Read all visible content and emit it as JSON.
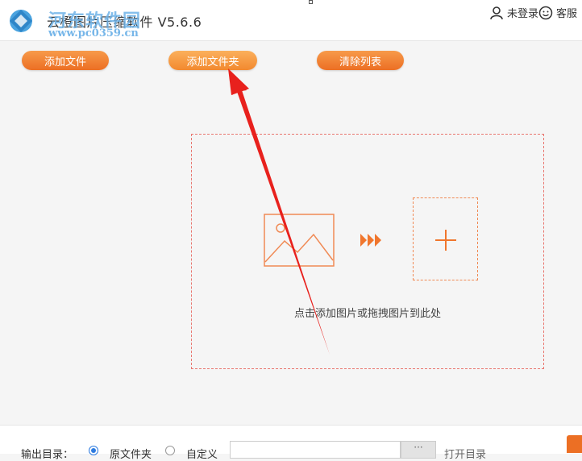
{
  "app": {
    "title": "云橙图片压缩软件 V5.6.6",
    "watermark_name": "河东软件园",
    "watermark_url": "www.pc0359.cn"
  },
  "header": {
    "login_label": "未登录",
    "service_label": "客服"
  },
  "toolbar": {
    "add_file": "添加文件",
    "add_folder": "添加文件夹",
    "clear_list": "清除列表"
  },
  "drop_zone": {
    "hint": "点击添加图片或拖拽图片到此处"
  },
  "output": {
    "label": "输出目录：",
    "option_original": "原文件夹",
    "option_custom": "自定义",
    "selected": "原文件夹",
    "path_value": "",
    "browse_label": "···",
    "open_dir": "打开目录"
  },
  "colors": {
    "accent": "#ec6f24",
    "drop_border": "#e9766f",
    "radio_checked": "#2d7be0",
    "annotation_arrow": "#e8211d"
  },
  "icons": {
    "logo": "app-logo-icon",
    "user": "user-icon",
    "service": "smiley-icon",
    "image": "image-icon",
    "arrows": "triple-arrow-icon",
    "add": "plus-icon"
  }
}
